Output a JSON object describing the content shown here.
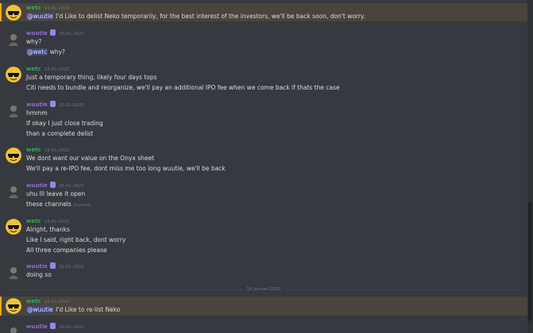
{
  "users": {
    "wetc": {
      "name": "wetc",
      "color": "#3ba55d"
    },
    "wuutie": {
      "name": "wuutie",
      "color": "#8f6cc9"
    }
  },
  "messages": [
    {
      "author": "wetc",
      "timestamp": "15-01-2022",
      "mention": "@wuutie",
      "lines": [
        "I'd Like to delist Neko temporarily, for the best interest of the investors, we'll be back soon, don't worry."
      ]
    },
    {
      "author": "wuutie",
      "timestamp": "15-01-2022",
      "lines": [
        "why?"
      ],
      "mention_line": {
        "mention": "@wetc",
        "text": "why?"
      }
    },
    {
      "author": "wetc",
      "timestamp": "15-01-2022",
      "lines": [
        "Just a temporary thing, likely four days tops",
        "Citi needs to bundle and reorganize, we'll pay an additional IPO fee when we come back if thats the case"
      ]
    },
    {
      "author": "wuutie",
      "timestamp": "15-01-2022",
      "lines": [
        "hmmm",
        "If okay I just close trading",
        "than a complete delist"
      ]
    },
    {
      "author": "wetc",
      "timestamp": "15-01-2022",
      "lines": [
        "We dont want our value on the Onyx sheet",
        "We'll pay a re-IPO fee, dont miss me too long wuutie, we'll be back"
      ]
    },
    {
      "author": "wuutie",
      "timestamp": "15-01-2022",
      "lines": [
        "uhu Ill leave it open",
        "these channels"
      ],
      "edited": "(bewerkt)"
    },
    {
      "author": "wetc",
      "timestamp": "15-01-2022",
      "lines": [
        "Alright, thanks",
        "Like I said, right back, dont worry",
        "All three companies please"
      ]
    },
    {
      "author": "wuutie",
      "timestamp": "15-01-2022",
      "lines": [
        "doing so"
      ]
    },
    {
      "author": "wetc",
      "timestamp": "16-01-2022",
      "mention": "@wuutie",
      "lines": [
        "I'd Like to re-list Neko"
      ]
    },
    {
      "author": "wuutie",
      "timestamp": "16-01-2022",
      "lines": []
    }
  ],
  "date_divider": "16 januari 2022"
}
